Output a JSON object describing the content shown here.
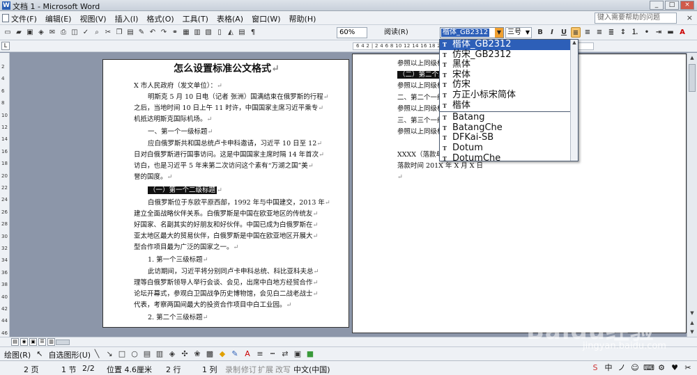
{
  "window": {
    "title": "文档 1 - Microsoft Word",
    "icon": "word-icon",
    "controls": [
      "minimize",
      "maximize",
      "close"
    ]
  },
  "menu": {
    "items": [
      "文件(F)",
      "编辑(E)",
      "视图(V)",
      "插入(I)",
      "格式(O)",
      "工具(T)",
      "表格(A)",
      "窗口(W)",
      "帮助(H)"
    ],
    "help_placeholder": "键入需要帮助的问题",
    "close_label": "×"
  },
  "toolbar": {
    "zoom": "60%",
    "read_label": "阅读(R)",
    "font_name": "楷体_GB2312",
    "font_size": "三号",
    "bold": "B",
    "italic": "I",
    "underline": "U",
    "font_color_label": "A",
    "accent": "#2d5fb8"
  },
  "ruler": {
    "scale": "6  4  2  |  2  4  6  8  10 12 14 16 18 20 22 24 26 28 30 32 34 36 38 40 42 44 46 48"
  },
  "vruler": [
    "2",
    "4",
    "6",
    "8",
    "10",
    "12",
    "14",
    "16",
    "18",
    "20",
    "22",
    "24",
    "26",
    "28",
    "30",
    "32",
    "34",
    "36",
    "38",
    "40",
    "42",
    "44",
    "46"
  ],
  "page1": {
    "title": "怎么设置标准公文格式",
    "lines": [
      "X 市人民政府（发文单位）：",
      "明斯克 5 月 10 日电（记者 张洲）国满结束在俄罗斯的行程",
      "之后，当地时间 10 日上午 11 时许，中国国家主席习近平乘专",
      "机抵达明斯克国际机场。",
      "一、第一个一级标题",
      "应白俄罗斯共和国总统卢卡申科邀请，习近平 10 日至 12",
      "日对白俄罗斯进行国事访问。这是中国国家主席时隔 14 年首次",
      "访白，也是习近平 5 年来第二次访问这个素有“万湖之国”美",
      "誉的国度。",
      "（一）第一个二级标题",
      "白俄罗斯位于东欧平原西部，1992 年与中国建交，2013 年",
      "建立全面战略伙伴关系。白俄罗斯是中国在欧亚地区的传统友",
      "好国家、名副其实的好朋友和好伙伴。中国已成为白俄罗斯在",
      "亚太地区最大的贸易伙伴，白俄罗斯是中国在欧亚地区开展大",
      "型合作项目最为广泛的国家之一。",
      "1. 第一个三级标题",
      "此访期间，习近平将分别同卢卡申科总统、科比亚科夫总",
      "理等白俄罗斯领导人举行会谈、会见，出席中白地方经贸合作",
      "论坛开幕式，参观白卫国战争历史博物馆，会见白二战老战士",
      "代表，考察两国间最大的投资合作项目中白工业园。",
      "2. 第二个三级标题"
    ]
  },
  "page2": {
    "lines": [
      "参照以上同级标",
      "（二）第二个二",
      "参照以上同级标",
      "二、第二个一级",
      "参照以上同级标",
      "三、第三个一级",
      "参照以上同级标",
      "XXXX（落款单位",
      "落款时间 201X 年 X 月 X 日"
    ]
  },
  "font_dropdown": {
    "recent": [
      "楷体_GB2312",
      "仿宋_GB2312",
      "黑体",
      "宋体",
      "仿宋",
      "方正小标宋简体",
      "楷体"
    ],
    "all": [
      "Batang",
      "BatangChe",
      "DFKai-SB",
      "Dotum",
      "DotumChe"
    ],
    "selected_index": 0,
    "tt_badge": "T"
  },
  "drawbar": {
    "draw_label": "绘图(R)",
    "autoshape_label": "自选图形(U)"
  },
  "status": {
    "page": "2 页",
    "section": "1 节",
    "page_of": "2/2",
    "position": "位置 4.6厘米",
    "line": "2 行",
    "column": "1 列",
    "rec": "录制",
    "track": "修订",
    "ext": "扩展",
    "ovr": "改写",
    "language": "中文(中国)"
  },
  "tray": {
    "items": [
      "S",
      "中",
      "ノ",
      "☺",
      "⌨",
      "⚙",
      "♥",
      "✂"
    ]
  },
  "watermark": {
    "brand": "Baidu经验",
    "url": "jingyan.baidu.com"
  }
}
